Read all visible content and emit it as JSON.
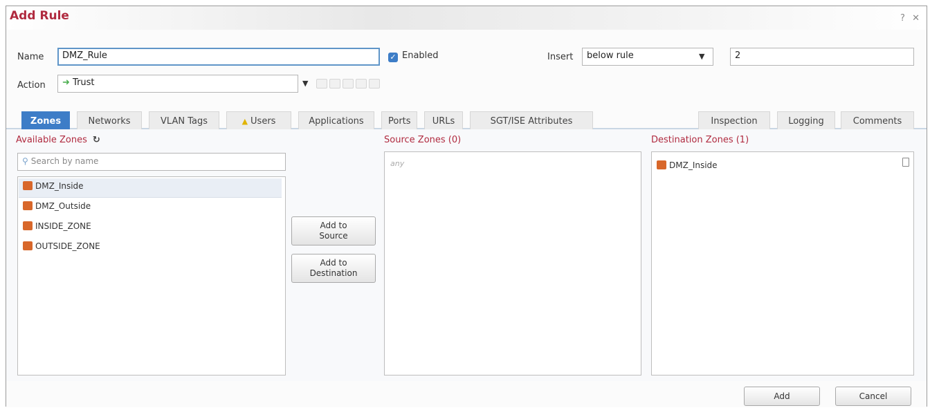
{
  "dialog": {
    "title": "Add Rule",
    "help_glyph": "?",
    "close_glyph": "✕"
  },
  "form": {
    "name_label": "Name",
    "name_value": "DMZ_Rule",
    "enabled_label": "Enabled",
    "enabled_checked": true,
    "insert_label": "Insert",
    "insert_value": "below rule",
    "insert_number": "2",
    "action_label": "Action",
    "action_value": "Trust",
    "action_icon": "arrow-right-icon"
  },
  "tabs": [
    {
      "label": "Zones",
      "active": true
    },
    {
      "label": "Networks"
    },
    {
      "label": "VLAN Tags"
    },
    {
      "label": "Users",
      "warning": true
    },
    {
      "label": "Applications"
    },
    {
      "label": "Ports"
    },
    {
      "label": "URLs"
    },
    {
      "label": "SGT/ISE Attributes"
    },
    {
      "label": "Inspection"
    },
    {
      "label": "Logging"
    },
    {
      "label": "Comments"
    }
  ],
  "available": {
    "title": "Available Zones",
    "search_placeholder": "Search by name",
    "items": [
      "DMZ_Inside",
      "DMZ_Outside",
      "INSIDE_ZONE",
      "OUTSIDE_ZONE"
    ]
  },
  "buttons": {
    "add_source_l1": "Add to",
    "add_source_l2": "Source",
    "add_dest_l1": "Add to",
    "add_dest_l2": "Destination",
    "add": "Add",
    "cancel": "Cancel"
  },
  "source": {
    "title": "Source Zones (0)",
    "empty_text": "any"
  },
  "destination": {
    "title": "Destination Zones (1)",
    "items": [
      "DMZ_Inside"
    ]
  },
  "colors": {
    "accent_red": "#b02a3f",
    "tab_active_blue": "#3d7dc7",
    "zone_icon_orange": "#d8672a"
  }
}
